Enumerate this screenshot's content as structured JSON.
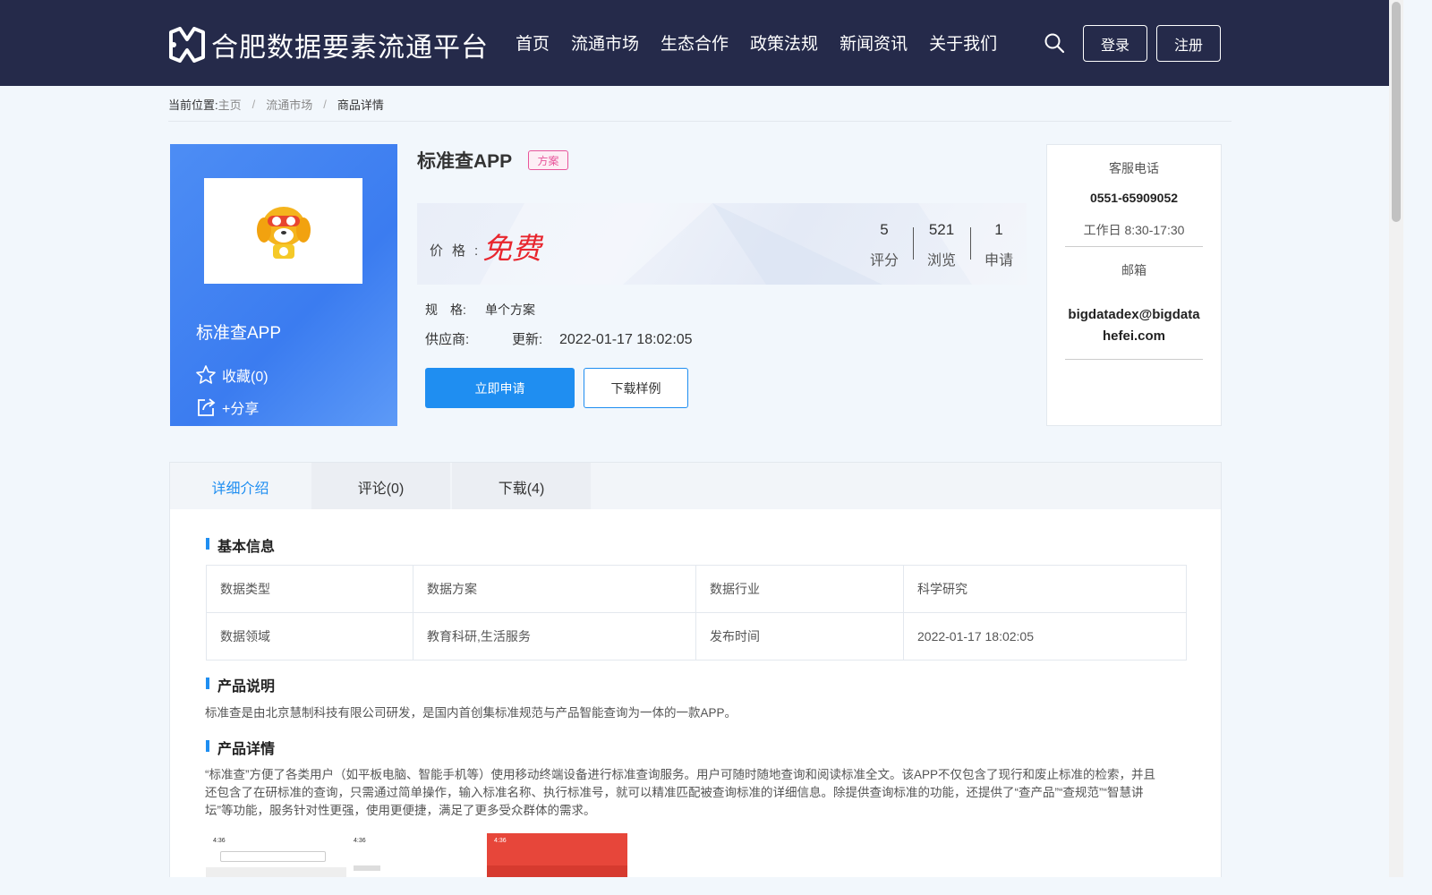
{
  "header": {
    "logo_text": "合肥数据要素流通平台",
    "nav": [
      "首页",
      "流通市场",
      "生态合作",
      "政策法规",
      "新闻资讯",
      "关于我们"
    ],
    "login": "登录",
    "register": "注册"
  },
  "breadcrumb": {
    "label": "当前位置:",
    "items": [
      "主页",
      "流通市场",
      "商品详情"
    ]
  },
  "product": {
    "name": "标准查APP",
    "title": "标准查APP",
    "tag": "方案",
    "favorite": "收藏(0)",
    "share": "+分享",
    "price_label": "价格:",
    "price": "免费",
    "stats": [
      {
        "num": "5",
        "label": "评分"
      },
      {
        "num": "521",
        "label": "浏览"
      },
      {
        "num": "1",
        "label": "申请"
      }
    ],
    "spec_label": "规　格:",
    "spec_value": "单个方案",
    "supplier_label": "供应商:",
    "update_label": "更新:",
    "update_value": "2022-01-17 18:02:05",
    "apply": "立即申请",
    "download": "下载样例"
  },
  "contact": {
    "phone_label": "客服电话",
    "phone": "0551-65909052",
    "hours": "工作日 8:30-17:30",
    "email_label": "邮箱",
    "email_line1": "bigdatadex@bigdata",
    "email_line2": "hefei.com"
  },
  "tabs": [
    "详细介绍",
    "评论(0)",
    "下载(4)"
  ],
  "basic": {
    "title": "基本信息",
    "rows": [
      [
        "数据类型",
        "数据方案",
        "数据行业",
        "科学研究"
      ],
      [
        "数据领域",
        "教育科研,生活服务",
        "发布时间",
        "2022-01-17 18:02:05"
      ]
    ]
  },
  "desc": {
    "title": "产品说明",
    "text": "标准查是由北京慧制科技有限公司研发，是国内首创集标准规范与产品智能查询为一体的一款APP。"
  },
  "detail": {
    "title": "产品详情",
    "line1": "“标准查”方便了各类用户（如平板电脑、智能手机等）使用移动终端设备进行标准查询服务。用户可随时随地查询和阅读标准全文。该APP不仅包含了现行和废止标准的检索，并且",
    "line2": "还包含了在研标准的查询，只需通过简单操作，输入标准名称、执行标准号，就可以精准匹配被查询标准的详细信息。除提供查询标准的功能，还提供了“查产品”“查规范”“智慧讲",
    "line3": "坛”等功能，服务针对性更强，使用更便捷，满足了更多受众群体的需求。"
  },
  "shots": [
    "4:36",
    "4:36",
    "4:36"
  ],
  "colors": {
    "header": "#252a4a",
    "accent": "#1f8ef1",
    "price": "#e8262e",
    "tag": "#e8559b"
  }
}
